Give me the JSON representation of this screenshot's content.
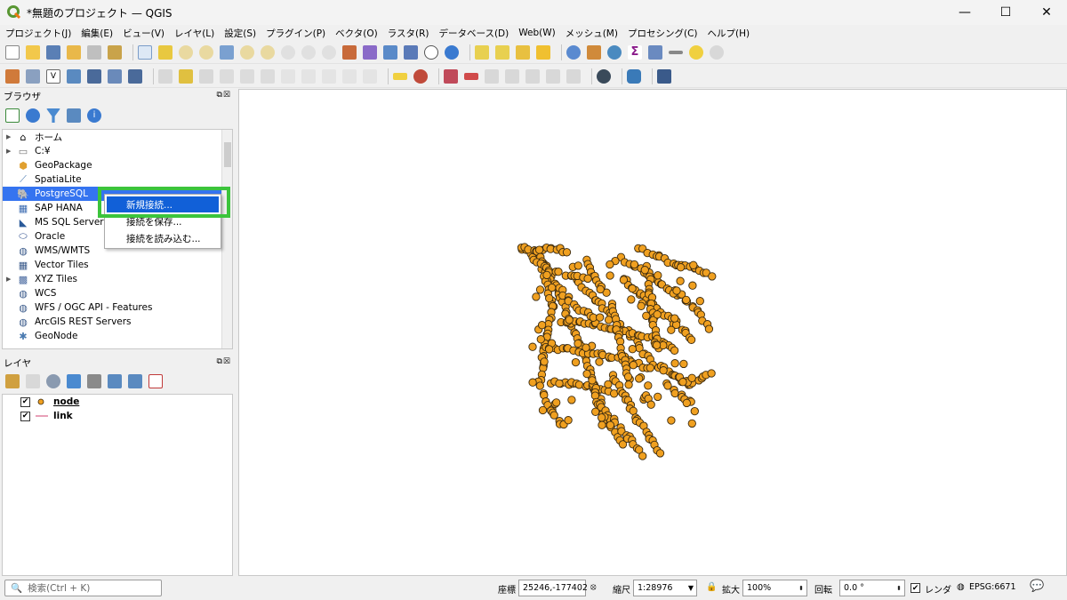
{
  "window": {
    "title": "*無題のプロジェクト — QGIS",
    "controls": [
      "—",
      "☐",
      "✕"
    ]
  },
  "menu": [
    "プロジェクト(J)",
    "編集(E)",
    "ビュー(V)",
    "レイヤ(L)",
    "設定(S)",
    "プラグイン(P)",
    "ベクタ(O)",
    "ラスタ(R)",
    "データベース(D)",
    "Web(W)",
    "メッシュ(M)",
    "プロセシング(C)",
    "ヘルプ(H)"
  ],
  "browser": {
    "title": "ブラウザ",
    "items": [
      {
        "label": "ホーム",
        "icon": "home-icon",
        "expandable": true
      },
      {
        "label": "C:¥",
        "icon": "folder-icon",
        "expandable": true
      },
      {
        "label": "GeoPackage",
        "icon": "geopackage-icon",
        "expandable": false
      },
      {
        "label": "SpatiaLite",
        "icon": "spatialite-icon",
        "expandable": false
      },
      {
        "label": "PostgreSQL",
        "icon": "postgresql-icon",
        "expandable": false
      },
      {
        "label": "SAP HANA",
        "icon": "sap-hana-icon",
        "expandable": false
      },
      {
        "label": "MS SQL Server",
        "icon": "mssql-icon",
        "expandable": false
      },
      {
        "label": "Oracle",
        "icon": "oracle-icon",
        "expandable": false
      },
      {
        "label": "WMS/WMTS",
        "icon": "wms-icon",
        "expandable": false
      },
      {
        "label": "Vector Tiles",
        "icon": "vector-tiles-icon",
        "expandable": false
      },
      {
        "label": "XYZ Tiles",
        "icon": "xyz-tiles-icon",
        "expandable": true
      },
      {
        "label": "WCS",
        "icon": "wcs-icon",
        "expandable": false
      },
      {
        "label": "WFS / OGC API - Features",
        "icon": "wfs-icon",
        "expandable": false
      },
      {
        "label": "ArcGIS REST Servers",
        "icon": "arcgis-icon",
        "expandable": false
      },
      {
        "label": "GeoNode",
        "icon": "geonode-icon",
        "expandable": false
      }
    ]
  },
  "context_menu": {
    "items": [
      "新規接続...",
      "接続を保存...",
      "接続を読み込む..."
    ]
  },
  "layers": {
    "title": "レイヤ",
    "items": [
      {
        "label": "node",
        "checked": true,
        "symbol": "point"
      },
      {
        "label": "link",
        "checked": true,
        "symbol": "line"
      }
    ]
  },
  "statusbar": {
    "search_placeholder": "検索(Ctrl + K)",
    "coord_label": "座標",
    "coord_value": "25246,-177402",
    "scale_label": "縮尺",
    "scale_value": "1:28976",
    "magnify_label": "拡大",
    "magnify_value": "100%",
    "rotation_label": "回転",
    "rotation_value": "0.0 °",
    "render_label": "レンダ",
    "crs": "EPSG:6671"
  },
  "colors": {
    "node_fill": "#f0a020",
    "node_stroke": "#3a2a10",
    "link": "#e080a0",
    "highlight": "#3cc43c",
    "menu_active": "#1160d8"
  }
}
